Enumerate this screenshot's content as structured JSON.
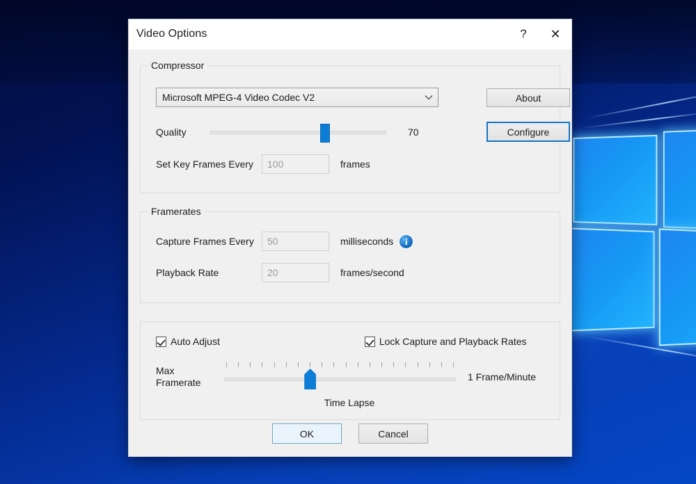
{
  "window": {
    "title": "Video Options",
    "help_icon": "question-mark-icon",
    "help_label": "?",
    "close_icon": "close-icon",
    "close_label": "✕"
  },
  "compressor": {
    "legend": "Compressor",
    "codec": {
      "selected": "Microsoft MPEG-4 Video Codec V2",
      "arrow_icon": "chevron-down-icon",
      "arrow_glyph": "∨",
      "options": [
        "Microsoft MPEG-4 Video Codec V2"
      ]
    },
    "about_label": "About",
    "configure_label": "Configure",
    "quality": {
      "label": "Quality",
      "value": "70",
      "min": 0,
      "max": 100,
      "thumb_percent": 65
    },
    "keyframes": {
      "label": "Set Key Frames Every",
      "value": "100",
      "unit": "frames"
    }
  },
  "framerates": {
    "legend": "Framerates",
    "capture": {
      "label": "Capture Frames Every",
      "value": "50",
      "unit": "milliseconds",
      "info_icon": "info-icon",
      "info_glyph": "i"
    },
    "playback": {
      "label": "Playback Rate",
      "value": "20",
      "unit": "frames/second"
    }
  },
  "timelapse": {
    "auto_adjust": {
      "label": "Auto Adjust",
      "checked": true
    },
    "lock_rates": {
      "label": "Lock Capture and Playback Rates",
      "checked": true
    },
    "max_framerate": {
      "label": "Max\nFramerate",
      "label_line1": "Max",
      "label_line2": "Framerate",
      "right_label": "1 Frame/Minute",
      "caption": "Time Lapse",
      "tick_count": 20,
      "thumb_percent": 37
    }
  },
  "footer": {
    "ok_label": "OK",
    "cancel_label": "Cancel"
  },
  "colors": {
    "accent_blue": "#0c7cd5",
    "focus_blue": "#1273c4",
    "dialog_bg": "#f0f0f0",
    "titlebar_bg": "#ffffff",
    "text": "#1b1b1b",
    "disabled_text": "#9b9b9b",
    "desktop_blue": "#0546c4"
  }
}
